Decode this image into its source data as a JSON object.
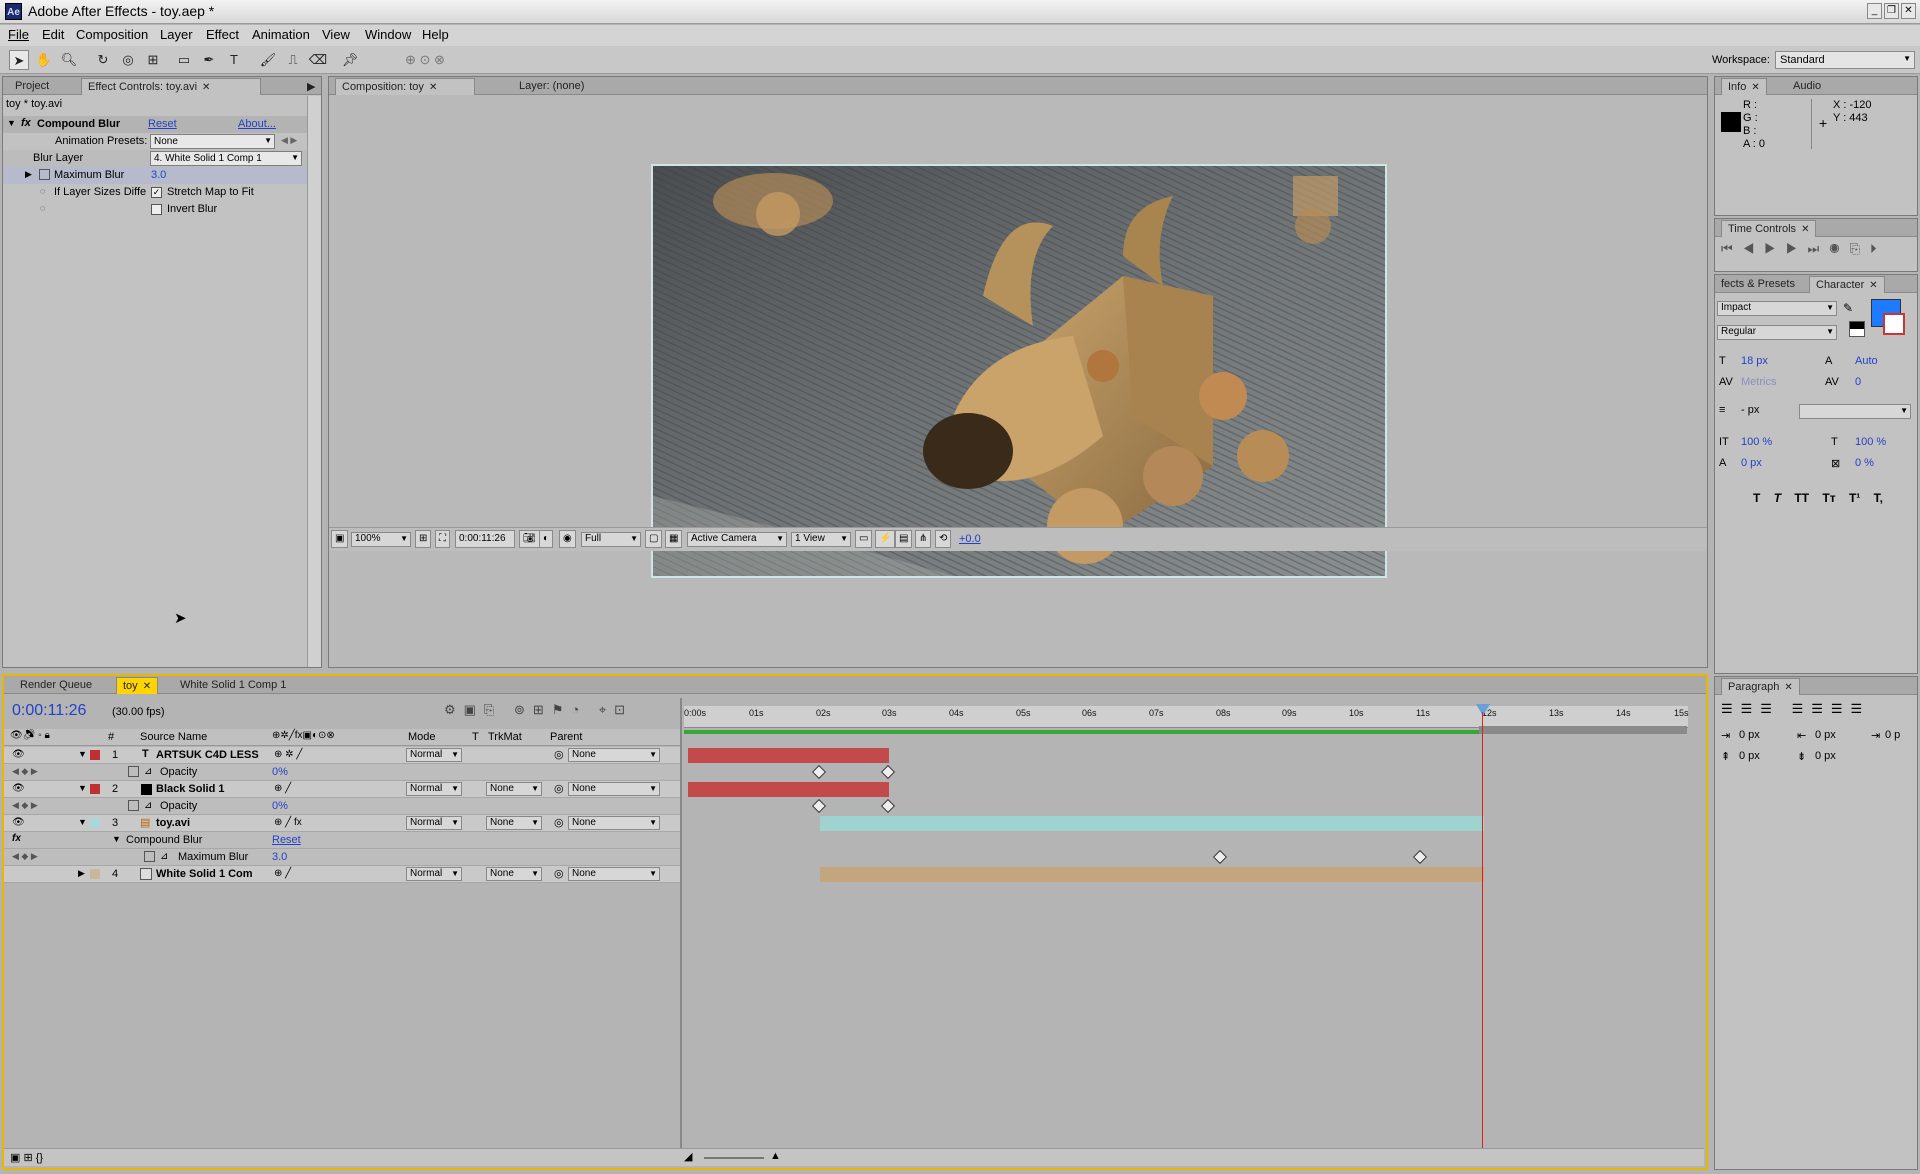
{
  "app": {
    "title": "Adobe After Effects - toy.aep *",
    "icon": "after-effects-icon"
  },
  "menu": [
    "File",
    "Edit",
    "Composition",
    "Layer",
    "Effect",
    "Animation",
    "View",
    "Window",
    "Help"
  ],
  "workspace": {
    "label": "Workspace:",
    "value": "Standard"
  },
  "project_panel": {
    "tabs": [
      "Project",
      "Effect Controls: toy.avi"
    ],
    "path": "toy * toy.avi",
    "effect": {
      "name": "Compound Blur",
      "reset": "Reset",
      "about": "About...",
      "presets_label": "Animation Presets:",
      "presets_value": "None",
      "blur_layer_label": "Blur Layer",
      "blur_layer_value": "4. White Solid 1 Comp 1",
      "max_blur_label": "Maximum Blur",
      "max_blur_value": "3.0",
      "if_sizes_label": "If Layer Sizes Diffe",
      "stretch_label": "Stretch Map to Fit",
      "invert_label": "Invert Blur"
    }
  },
  "comp_panel": {
    "tabs": [
      "Composition: toy",
      "Layer: (none)"
    ],
    "zoom": "100%",
    "timecode": "0:00:11:26",
    "resolution": "Full",
    "camera": "Active Camera",
    "views": "1 View",
    "exposure": "+0.0"
  },
  "info_panel": {
    "tabs": [
      "Info",
      "Audio"
    ],
    "r": "R :",
    "g": "G :",
    "b": "B :",
    "a": "A : 0",
    "x": "X : -120",
    "y": "Y : 443"
  },
  "time_controls": {
    "tab": "Time Controls"
  },
  "character": {
    "tabs": [
      "fects & Presets",
      "Character"
    ],
    "font": "Impact",
    "style": "Regular",
    "size": "18 px",
    "leading": "Auto",
    "kerning": "Metrics",
    "tracking": "0",
    "stroke": "- px",
    "vscale": "100 %",
    "hscale": "100 %",
    "baseline": "0 px",
    "tsume": "0 %",
    "styles": [
      "T",
      "T",
      "TT",
      "Tт",
      "T¹",
      "T,"
    ]
  },
  "paragraph": {
    "tab": "Paragraph",
    "indent_left": "0 px",
    "indent_right": "0 px",
    "indent_first": "0 px",
    "space_before": "0 px",
    "space_after": "0 px",
    "extra": "0 p"
  },
  "timeline": {
    "tabs": [
      "Render Queue",
      "toy",
      "White Solid 1 Comp 1"
    ],
    "timecode": "0:00:11:26",
    "fps": "(30.00 fps)",
    "headers": {
      "num": "#",
      "source": "Source Name",
      "mode": "Mode",
      "t": "T",
      "trkmat": "TrkMat",
      "parent": "Parent"
    },
    "ruler": [
      "0:00s",
      "01s",
      "02s",
      "03s",
      "04s",
      "05s",
      "06s",
      "07s",
      "08s",
      "09s",
      "10s",
      "11s",
      "12s",
      "13s",
      "14s",
      "15s"
    ],
    "layers": [
      {
        "num": "1",
        "name": "ARTSUK C4D LESS",
        "mode": "Normal",
        "trkmat": "",
        "parent": "None",
        "color": "#c03030",
        "prop": "Opacity",
        "prop_value": "0%"
      },
      {
        "num": "2",
        "name": "Black Solid 1",
        "mode": "Normal",
        "trkmat": "None",
        "parent": "None",
        "color": "#c03030",
        "prop": "Opacity",
        "prop_value": "0%"
      },
      {
        "num": "3",
        "name": "toy.avi",
        "mode": "Normal",
        "trkmat": "None",
        "parent": "None",
        "color": "#a8d8d8",
        "effect": "Compound Blur",
        "effect_reset": "Reset",
        "prop": "Maximum Blur",
        "prop_value": "3.0"
      },
      {
        "num": "4",
        "name": "White Solid 1 Com",
        "mode": "Normal",
        "trkmat": "None",
        "parent": "None",
        "color": "#c8b89a"
      }
    ]
  },
  "colors": {
    "accent": "#2342c6",
    "playhead": "#e02020",
    "red_bar": "#c34a4a",
    "teal_bar": "#9fd3d0",
    "tan_bar": "#c4a67e",
    "work_area": "#3aa63a",
    "swatch_fill": "#1e7bff"
  }
}
